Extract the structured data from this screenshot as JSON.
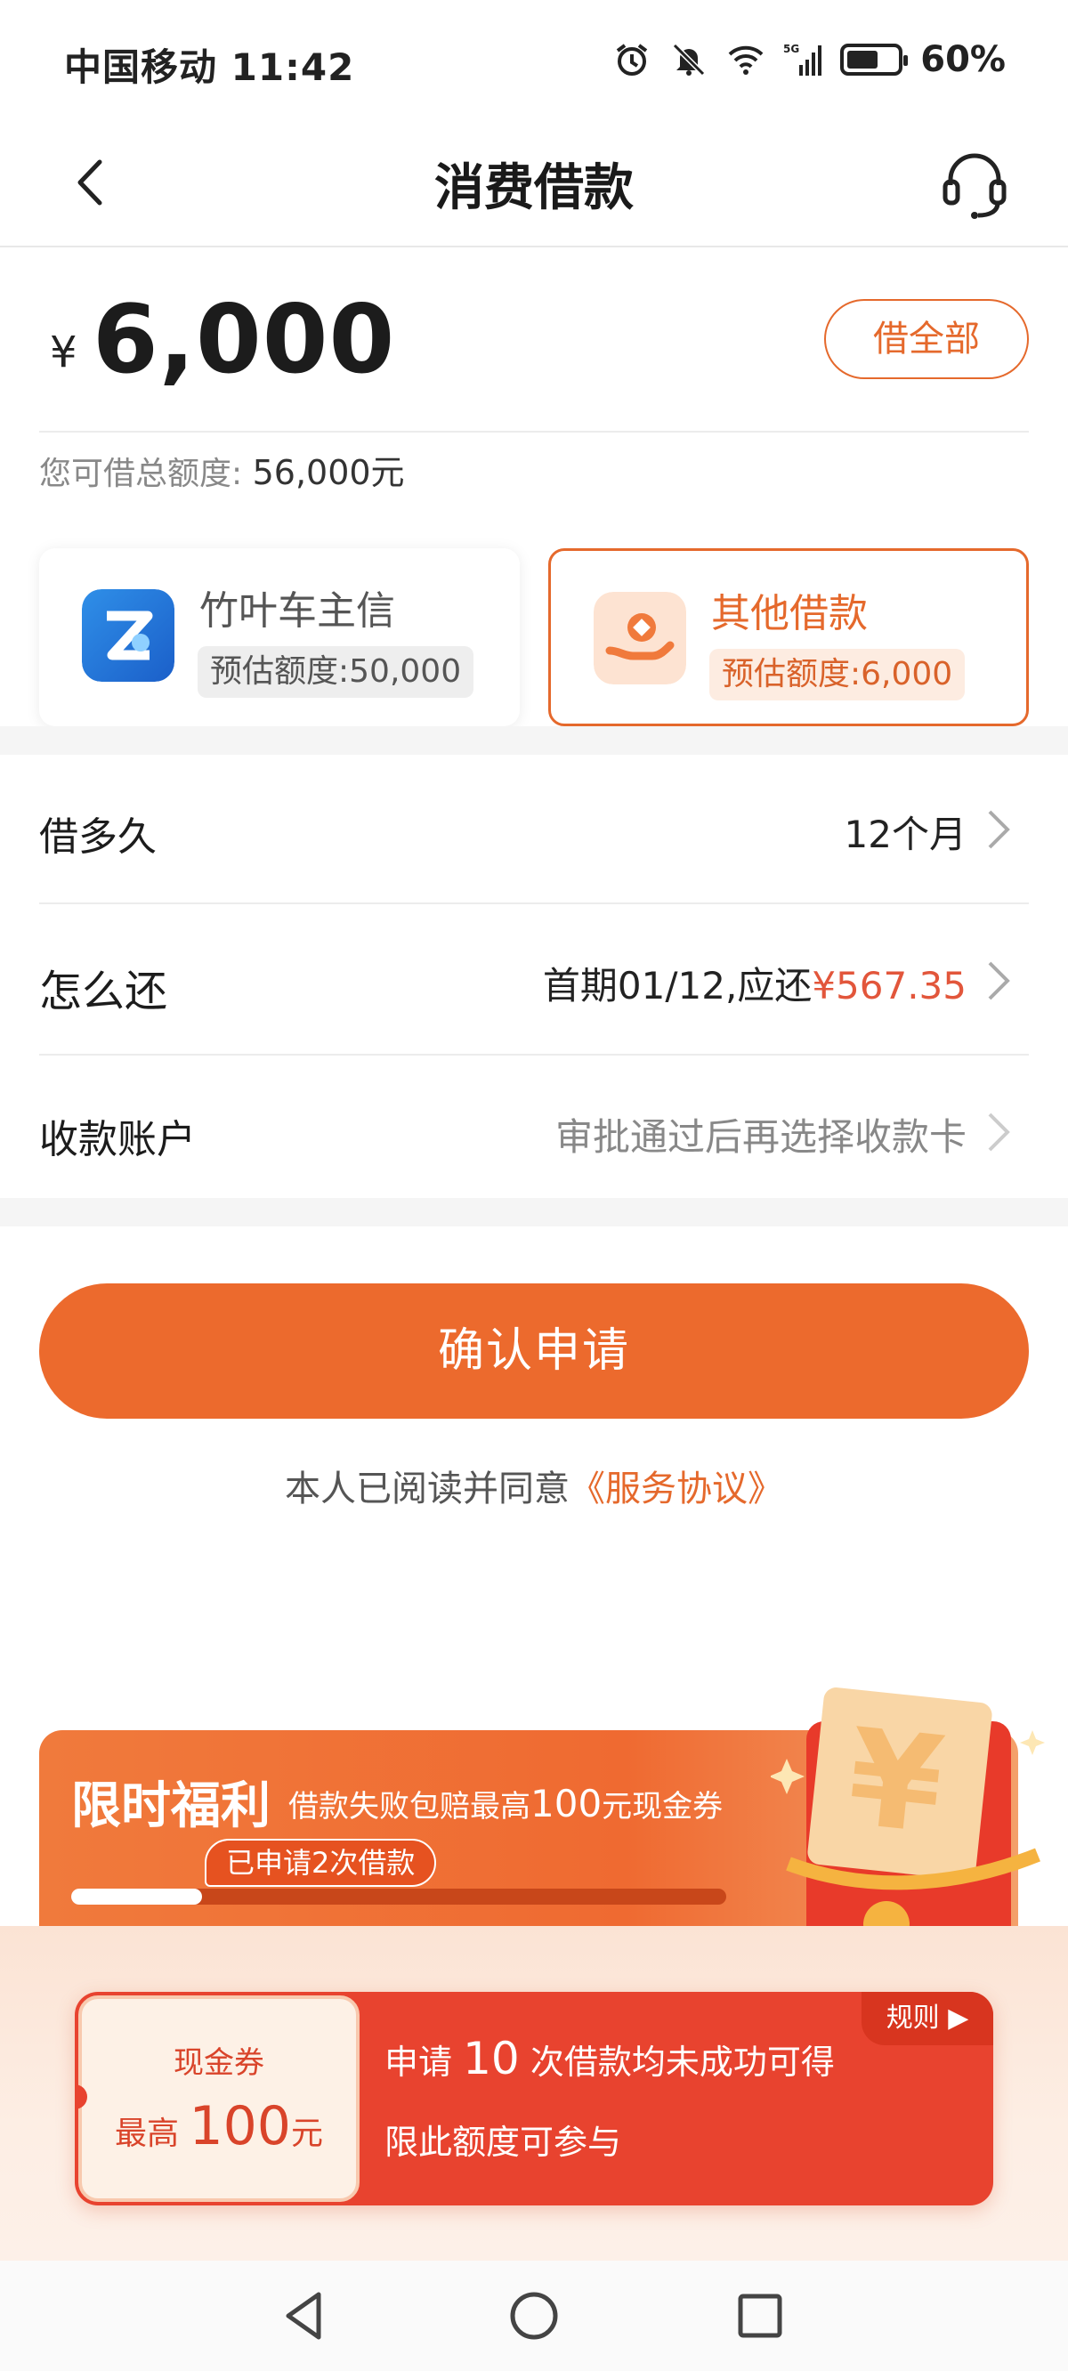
{
  "status_bar": {
    "carrier_time": "中国移动 11:42",
    "battery": "60%",
    "icons": [
      "alarm-icon",
      "mute-icon",
      "wifi-icon",
      "signal-5g-icon",
      "battery-icon"
    ]
  },
  "header": {
    "title": "消费借款",
    "back_icon": "back-arrow-icon",
    "support_icon": "headset-icon"
  },
  "amount": {
    "currency": "¥",
    "value": "6,000",
    "borrow_all_label": "借全部"
  },
  "total_quota": {
    "label": "您可借总额度:",
    "value": "56,000元"
  },
  "products": [
    {
      "name": "竹叶车主信",
      "quota": "预估额度:50,000",
      "selected": false
    },
    {
      "name": "其他借款",
      "quota": "预估额度:6,000",
      "selected": true
    }
  ],
  "rows": {
    "term": {
      "label": "借多久",
      "value": "12个月"
    },
    "repay": {
      "label": "怎么还",
      "value_prefix": "首期01/12,应还",
      "value_amount": "¥567.35"
    },
    "account": {
      "label": "收款账户",
      "value": "审批通过后再选择收款卡"
    }
  },
  "confirm_label": "确认申请",
  "agreement": {
    "text": "本人已阅读并同意",
    "link": "《服务协议》"
  },
  "promo": {
    "title": "限时福利",
    "subtitle_pre": "借款失败包赔最高",
    "subtitle_amount": "100",
    "subtitle_post": "元现金券",
    "progress_tip": "已申请2次借款",
    "progress": 0.2
  },
  "coupon": {
    "type": "现金券",
    "amount_pre": "最高",
    "amount": "100",
    "amount_unit": "元",
    "line1_pre": "申请",
    "line1_num": "10",
    "line1_post": "次借款均未成功可得",
    "line2": "限此额度可参与",
    "rules_label": "规则 ▶"
  },
  "colors": {
    "accent": "#ec6a2d",
    "price_red": "#e2563b",
    "coupon_red": "#e8432f"
  }
}
